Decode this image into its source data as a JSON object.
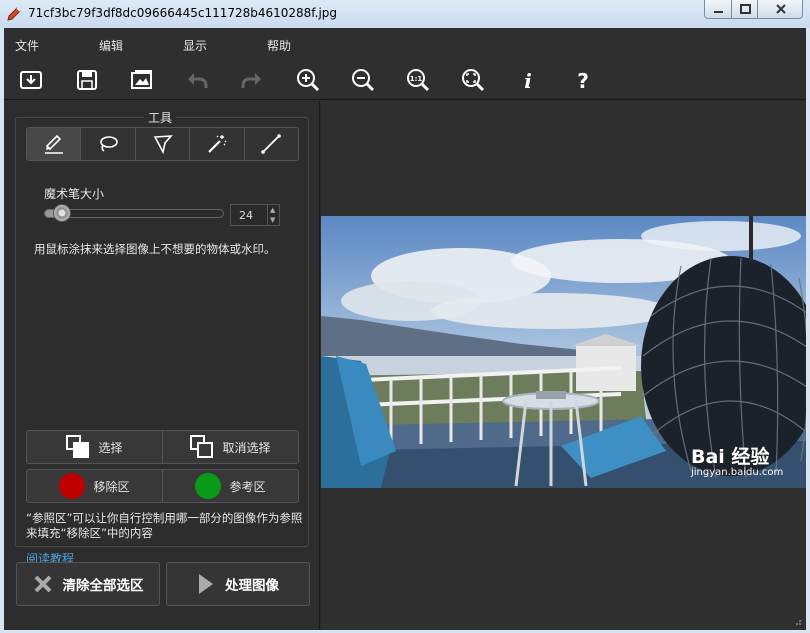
{
  "window": {
    "title": "71cf3bc79f3df8dc09666445c111728b4610288f.jpg"
  },
  "menu": {
    "file": "文件",
    "edit": "编辑",
    "view": "显示",
    "help": "帮助"
  },
  "toolbar_icons": [
    "open-icon",
    "save-icon",
    "image-icon",
    "undo-icon",
    "redo-icon",
    "zoom-in-icon",
    "zoom-out-icon",
    "zoom-actual-icon",
    "zoom-fit-icon",
    "info-icon",
    "help-icon"
  ],
  "tools_panel": {
    "title": "工具",
    "tools": [
      "marker-icon",
      "lasso-icon",
      "polygon-lasso-icon",
      "magic-wand-icon",
      "line-icon"
    ],
    "brush_size_label": "魔术笔大小",
    "brush_size_value": "24",
    "brush_size_fraction": 0.1,
    "hint": "用鼠标涂抹来选择图像上不想要的物体或水印。",
    "select_label": "选择",
    "deselect_label": "取消选择",
    "remove_area_label": "移除区",
    "reference_area_label": "参考区",
    "reference_note": "“参照区”可以让你自行控制用哪一部分的图像作为参照来填充“移除区”中的内容",
    "tutorial_link": "阅读教程"
  },
  "actions": {
    "clear_all": "清除全部选区",
    "process": "处理图像"
  },
  "colors": {
    "remove_area": "#c00000",
    "reference_area": "#0a9a1a"
  },
  "watermark": {
    "main": "Bai 经验",
    "sub": "jingyan.baidu.com"
  }
}
